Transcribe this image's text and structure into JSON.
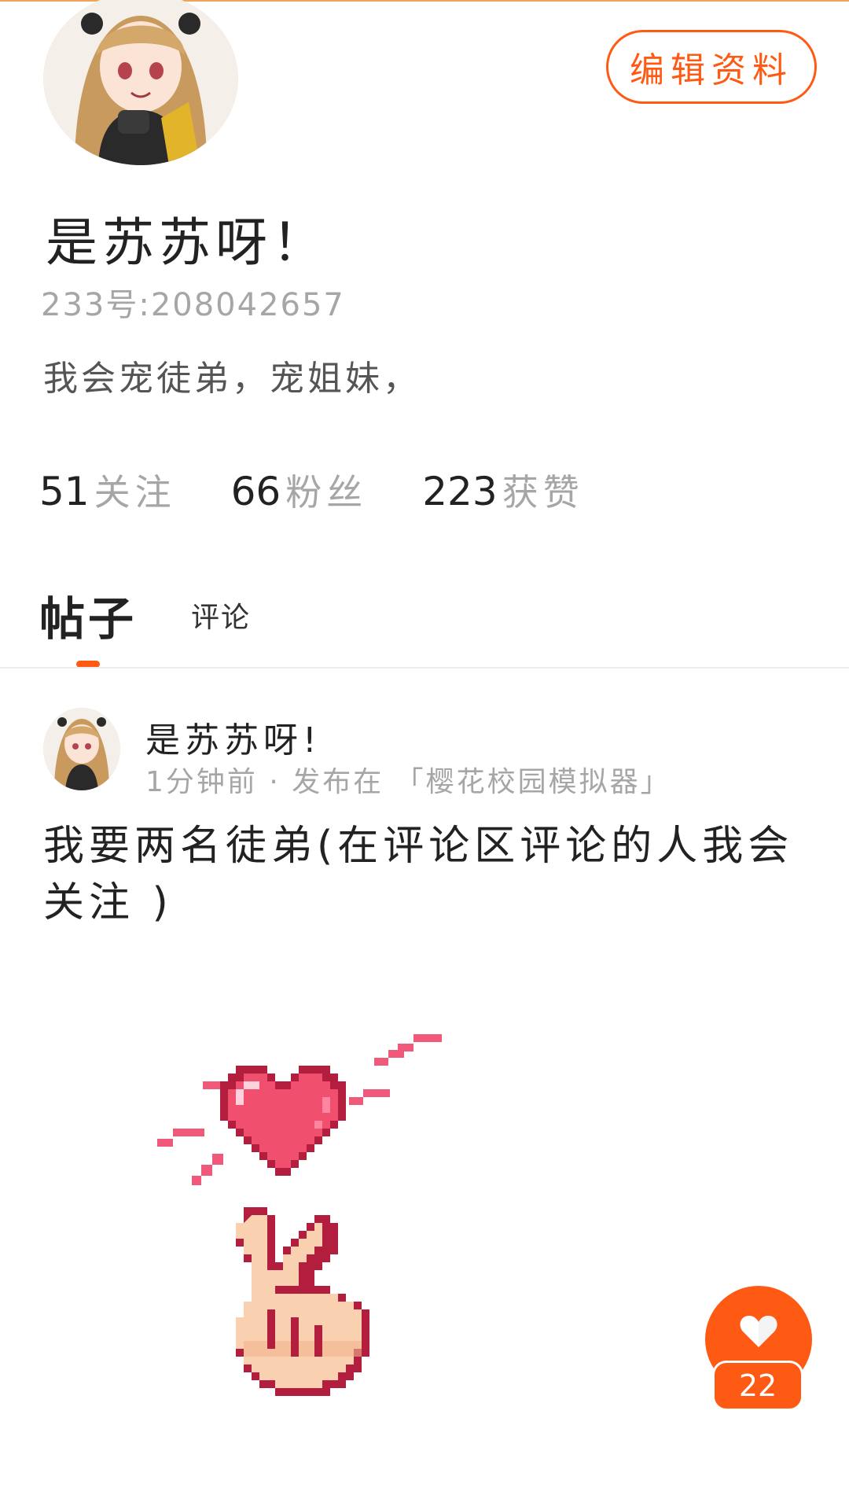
{
  "header": {
    "edit_button": "编辑资料"
  },
  "profile": {
    "name": "是苏苏呀！",
    "id_text": "233号:208042657",
    "bio": "我会宠徒弟，宠姐妹，",
    "avatar": "anime-girl-avatar",
    "stats": [
      {
        "num": "51",
        "label": "关注"
      },
      {
        "num": "66",
        "label": "粉丝"
      },
      {
        "num": "223",
        "label": "获赞"
      }
    ]
  },
  "tabs": {
    "posts": "帖子",
    "comments": "评论",
    "active": "posts"
  },
  "post": {
    "author": "是苏苏呀!",
    "meta": "1分钟前 · 发布在 「樱花校园模拟器」",
    "text": "我要两名徒弟(在评论区评论的人我会关注 )",
    "image": "pixel-heart-finger-heart"
  },
  "like": {
    "icon": "heart-icon",
    "count": "22"
  },
  "colors": {
    "accent": "#ff5a14",
    "muted": "#a6a6a6",
    "text": "#222222"
  }
}
